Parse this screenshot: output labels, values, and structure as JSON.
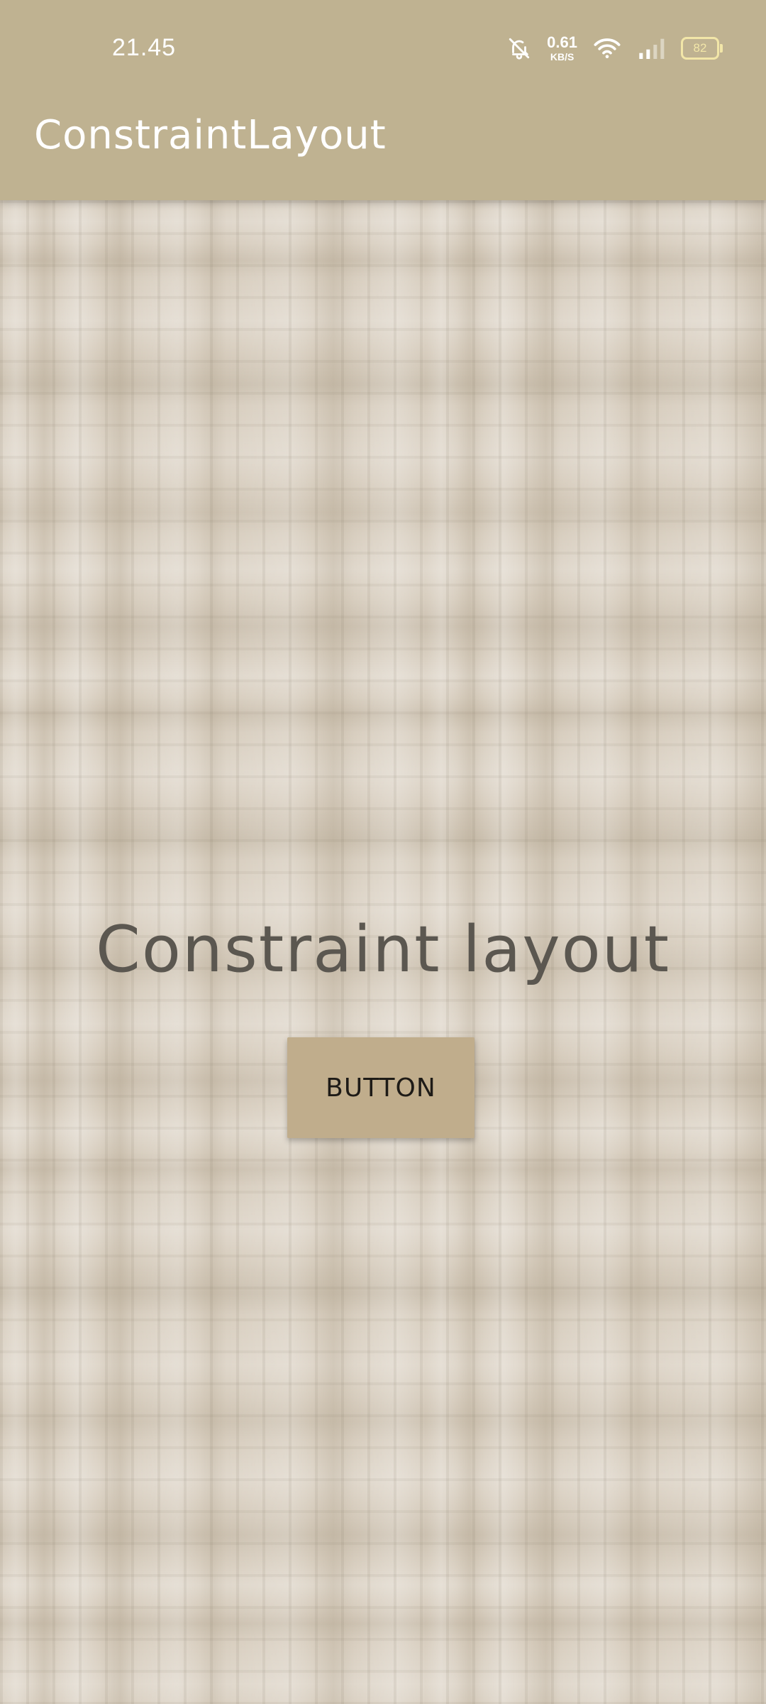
{
  "status_bar": {
    "time": "21.45",
    "net_speed_value": "0.61",
    "net_speed_unit": "KB/S",
    "battery_level": "82",
    "icons": [
      "bell-off-icon",
      "wifi-icon",
      "signal-icon",
      "battery-icon"
    ]
  },
  "app_bar": {
    "title": "ConstraintLayout"
  },
  "main": {
    "headline": "Constraint layout",
    "button_label": "BUTTON"
  },
  "colors": {
    "app_bar": "#bfb291",
    "background": "#d8cebf",
    "button": "#c0ad8c",
    "headline_text": "#5b5750"
  }
}
